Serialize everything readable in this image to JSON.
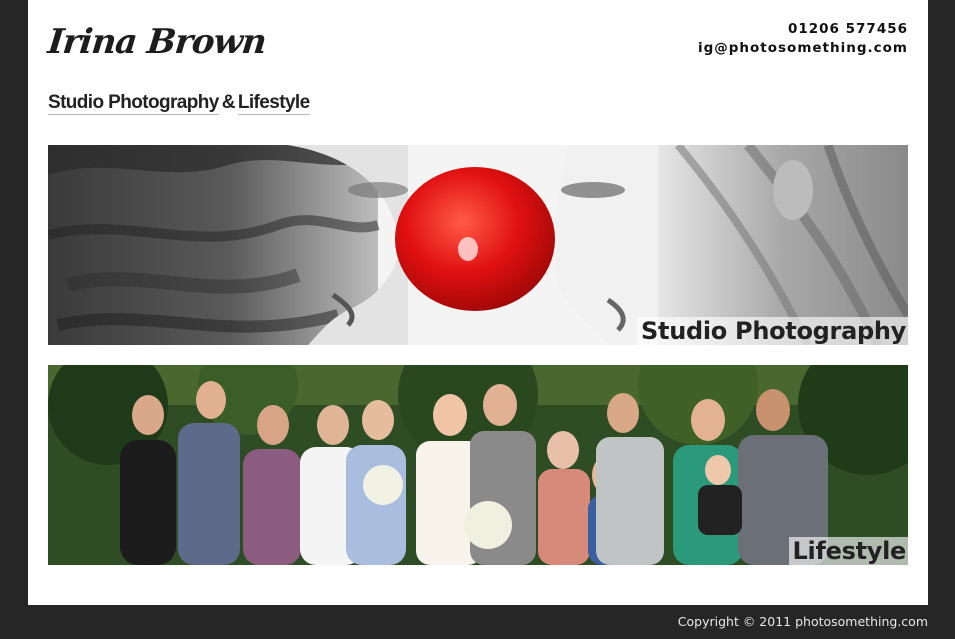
{
  "site": {
    "logo": "Irina Brown",
    "phone": "01206 577456",
    "email": "ig@photosomething.com"
  },
  "nav": {
    "studio": "Studio Photography",
    "amp": "&",
    "lifestyle": "Lifestyle"
  },
  "banners": [
    {
      "caption": "Studio Photography",
      "subject": "black and white studio portrait of two girls nose to nose with a red clown nose"
    },
    {
      "caption": "Lifestyle",
      "subject": "outdoor wedding group photo in front of trees"
    }
  ],
  "footer": {
    "copyright": "Copyright © 2011 photosomething.com"
  },
  "colors": {
    "background": "#262626",
    "page": "#ffffff",
    "text": "#222222",
    "clown_nose": "#e01010"
  }
}
